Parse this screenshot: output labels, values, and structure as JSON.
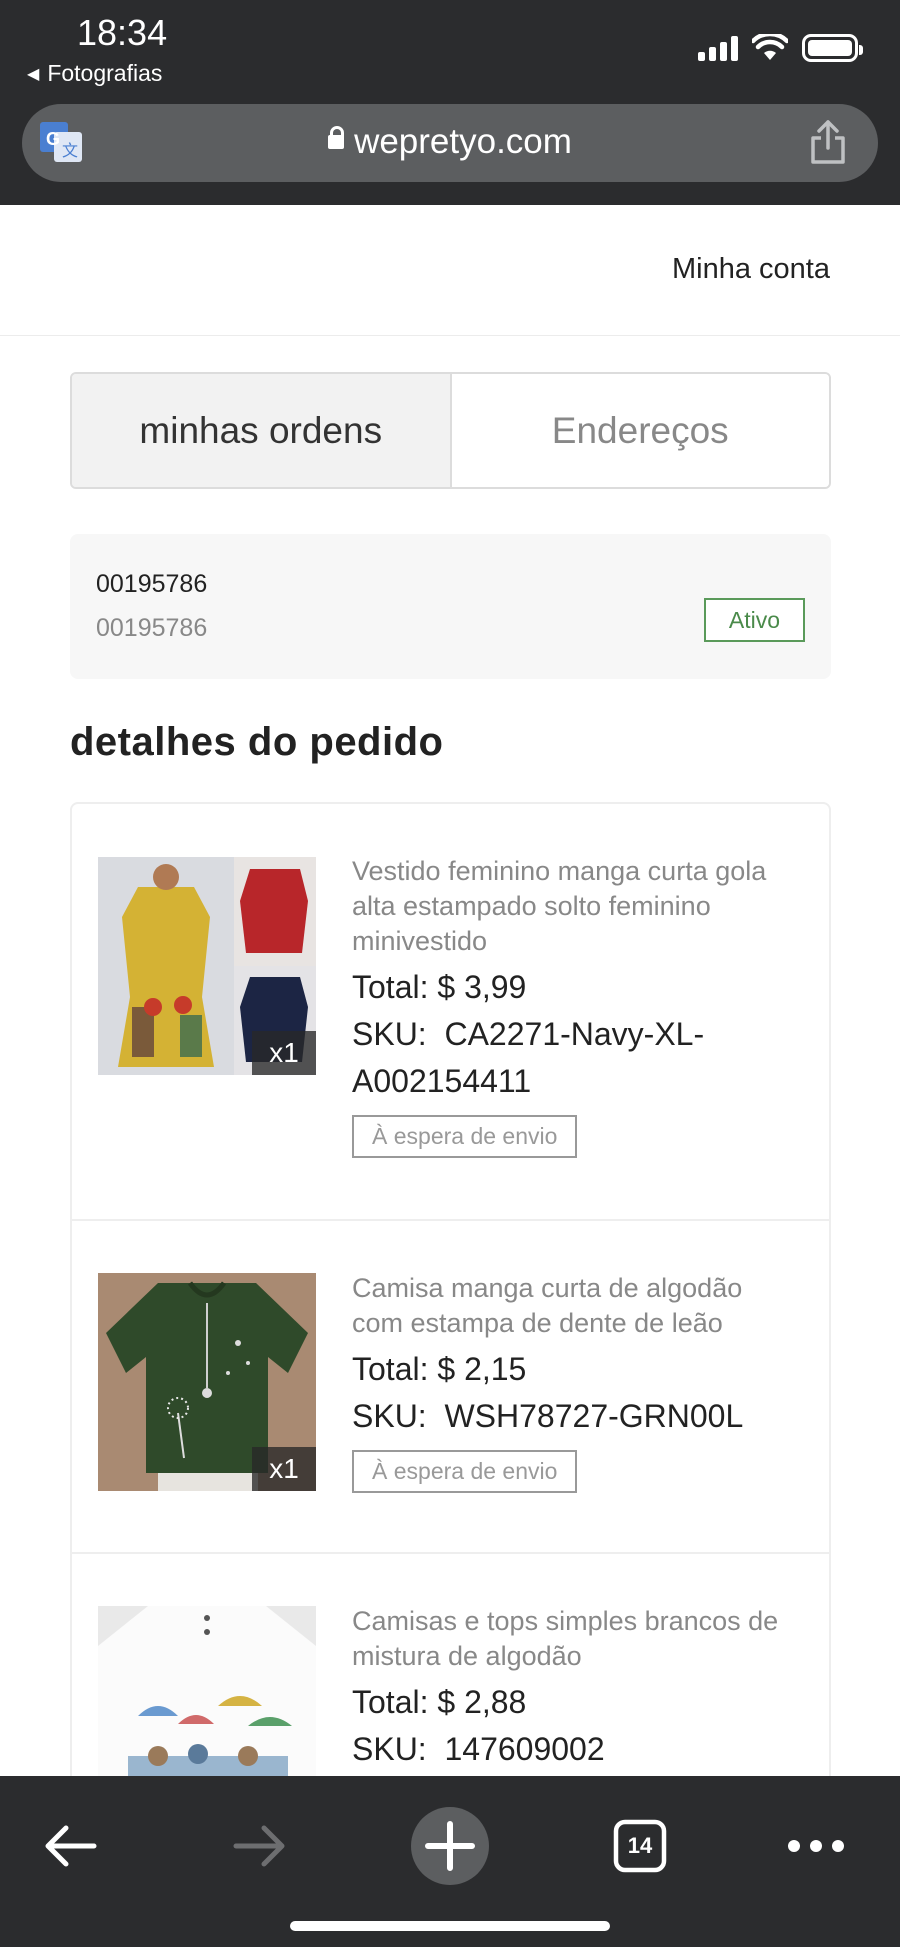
{
  "status_bar": {
    "time": "18:34",
    "back_app": "Fotografias"
  },
  "browser": {
    "url": "wepretyo.com",
    "tabs_count": "14"
  },
  "header": {
    "account_link": "Minha conta"
  },
  "tabs": [
    {
      "label": "minhas ordens",
      "active": true
    },
    {
      "label": "Endereços",
      "active": false
    }
  ],
  "order": {
    "number": "00195786",
    "number_secondary": "00195786",
    "status": "Ativo"
  },
  "section_title": "detalhes do pedido",
  "products": [
    {
      "name": "Vestido feminino manga curta gola alta estampado solto feminino minivestido",
      "total_label": "Total:",
      "total_value": "$ 3,99",
      "sku_label": "SKU:",
      "sku_value": "CA2271-Navy-XL-A002154411",
      "quantity": "x1",
      "status": "À espera de envio"
    },
    {
      "name": "Camisa manga curta de algodão com estampa de dente de leão",
      "total_label": "Total:",
      "total_value": "$ 2,15",
      "sku_label": "SKU:",
      "sku_value": "WSH78727-GRN00L",
      "quantity": "x1",
      "status": "À espera de envio"
    },
    {
      "name": "Camisas e tops simples brancos de mistura de algodão",
      "total_label": "Total:",
      "total_value": "$ 2,88",
      "sku_label": "SKU:",
      "sku_value": "147609002"
    }
  ],
  "colors": {
    "chrome_bg": "#2b2c2e",
    "status_green": "#4a8a4a",
    "muted_text": "#888888"
  }
}
